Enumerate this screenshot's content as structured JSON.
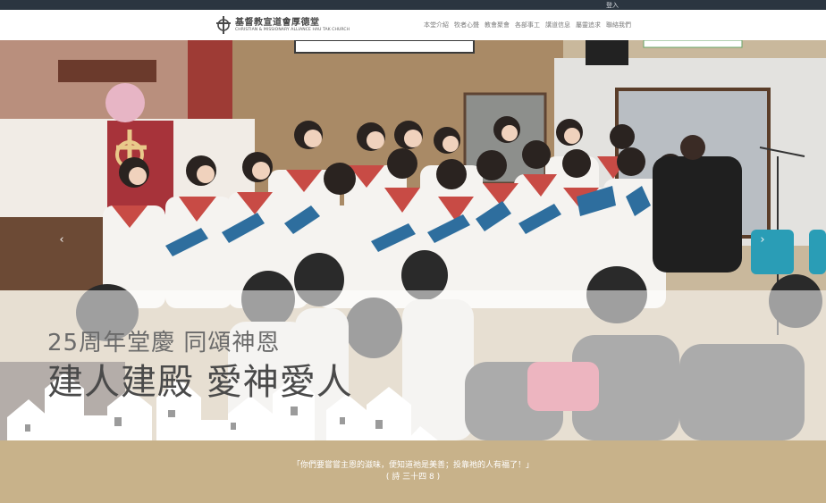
{
  "topbar": {
    "login_label": "登入"
  },
  "header": {
    "logo_zh": "基督教宣道會厚德堂",
    "logo_en": "CHRISTIAN & MISSIONARY ALLIANCE HAU TAK CHURCH",
    "nav": [
      "本堂介紹",
      "牧者心聲",
      "教會聚會",
      "各部事工",
      "講道信息",
      "屬靈追求",
      "聯絡我們"
    ]
  },
  "hero": {
    "headline_small": "25周年堂慶 同頌神恩",
    "headline_large": "建人建殿 愛神愛人",
    "prev_icon": "chevron-left-icon",
    "next_icon": "chevron-right-icon"
  },
  "footer": {
    "verse": "「你們要嘗嘗主恩的滋味，便知道祂是美善；投靠祂的人有福了！」",
    "reference": "( 詩 三十四 8 )"
  },
  "colors": {
    "topbar": "#2b3540",
    "footer_band": "#c8b28a",
    "nav_text": "#7a7a7a"
  }
}
